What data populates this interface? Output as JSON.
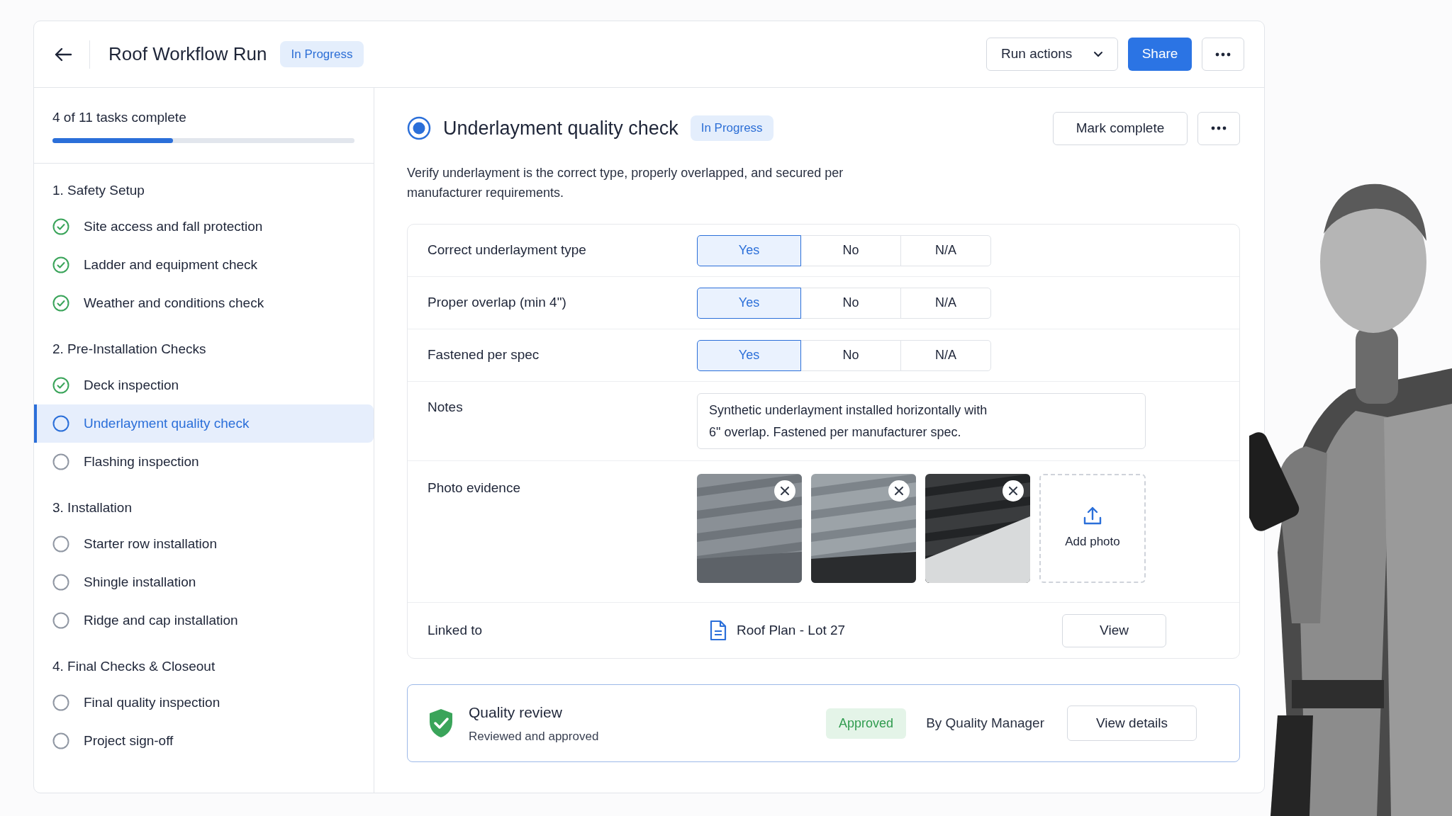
{
  "header": {
    "title": "Roof Workflow Run",
    "status": "In Progress",
    "run_actions": "Run actions",
    "share": "Share"
  },
  "sidebar": {
    "progress": {
      "text": "4 of 11 tasks complete",
      "level": 0.4
    },
    "groups": [
      {
        "title": "1.  Safety Setup",
        "tasks": [
          {
            "label": "Site access and fall protection",
            "kind": "done",
            "selected": false
          },
          {
            "label": "Ladder and equipment check",
            "kind": "done",
            "selected": false
          },
          {
            "label": "Weather and conditions check",
            "kind": "done",
            "selected": false
          }
        ]
      },
      {
        "title": "2.  Pre-Installation Checks",
        "tasks": [
          {
            "label": "Deck inspection",
            "kind": "done",
            "selected": false
          },
          {
            "label": "Underlayment quality check",
            "kind": "pending",
            "selected": true
          },
          {
            "label": "Flashing inspection",
            "kind": "pending",
            "selected": false
          }
        ]
      },
      {
        "title": "3.  Installation",
        "tasks": [
          {
            "label": "Starter row installation",
            "kind": "pending",
            "selected": false
          },
          {
            "label": "Shingle installation",
            "kind": "pending",
            "selected": false
          },
          {
            "label": "Ridge and cap installation",
            "kind": "pending",
            "selected": false
          }
        ]
      },
      {
        "title": "4.  Final Checks & Closeout",
        "tasks": [
          {
            "label": "Final quality inspection",
            "kind": "pending",
            "selected": false
          },
          {
            "label": "Project sign-off",
            "kind": "pending",
            "selected": false
          }
        ]
      }
    ]
  },
  "task": {
    "title": "Underlayment quality check",
    "status": "In Progress",
    "mark_complete": "Mark complete",
    "description": "Verify underlayment is the correct type, properly overlapped, and secured per manufacturer requirements.",
    "questions": [
      {
        "label": "Correct underlayment type",
        "options": [
          {
            "label": "Yes",
            "selected": true
          },
          {
            "label": "No",
            "selected": false
          },
          {
            "label": "N/A",
            "selected": false
          }
        ]
      },
      {
        "label": "Proper overlap (min  4\")",
        "options": [
          {
            "label": "Yes",
            "selected": true
          },
          {
            "label": "No",
            "selected": false
          },
          {
            "label": "N/A",
            "selected": false
          }
        ]
      },
      {
        "label": "Fastened per spec",
        "options": [
          {
            "label": "Yes",
            "selected": true
          },
          {
            "label": "No",
            "selected": false
          },
          {
            "label": "N/A",
            "selected": false
          }
        ]
      }
    ],
    "notes": {
      "label": "Notes",
      "value": "Synthetic underlayment installed horizontally with\n6\" overlap. Fastened per manufacturer spec."
    },
    "photos": {
      "label": "Photo evidence",
      "add_label": "Add photo"
    },
    "linked": {
      "label": "Linked to",
      "document": "Roof Plan - Lot 27",
      "button": "View"
    },
    "review": {
      "title": "Quality review",
      "subtitle": "Reviewed and approved",
      "status": "Approved",
      "by": "By Quality Manager",
      "button": "View details"
    }
  }
}
